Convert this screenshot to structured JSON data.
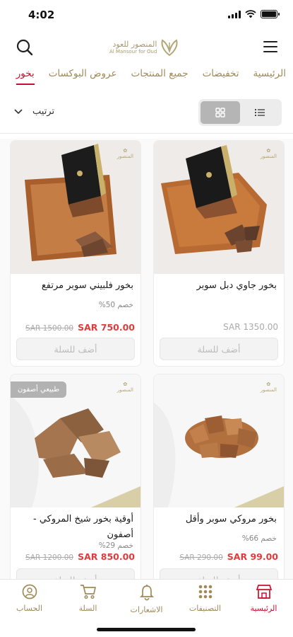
{
  "status_bar": {
    "time": "4:02"
  },
  "header": {
    "logo_ar": "المنصور للعود",
    "logo_en": "Al Mansour for Oud"
  },
  "tabs": [
    {
      "label": "الرئيسية",
      "active": false
    },
    {
      "label": "تخفيضات",
      "active": false
    },
    {
      "label": "جميع المنتجات",
      "active": false
    },
    {
      "label": "عروض البوكسات",
      "active": false
    },
    {
      "label": "بخور",
      "active": true
    }
  ],
  "toolbar": {
    "sort_label": "ترتيب",
    "view_mode": "grid"
  },
  "products": [
    {
      "title": "بخور جاوي دبل سوبر",
      "discount": "",
      "price": "",
      "old_price": "SAR 1350.00",
      "add_label": "أضف للسلة",
      "badge": ""
    },
    {
      "title": "بخور فلبيني سوبر مرتفع",
      "discount": "خصم 50%",
      "price": "SAR 750.00",
      "old_price": "SAR 1500.00",
      "add_label": "أضف للسلة",
      "badge": ""
    },
    {
      "title": "بخور مروكي سوبر وأقل",
      "discount": "خصم 66%",
      "price": "SAR 99.00",
      "old_price": "SAR 290.00",
      "add_label": "أضف للسلة",
      "badge": ""
    },
    {
      "title": "أوقية بخور شيخ المروكي - أصفون",
      "discount": "خصم 29%",
      "price": "SAR 850.00",
      "old_price": "SAR 1200.00",
      "add_label": "أضف للسلة",
      "badge": "طبيعي أصفون"
    }
  ],
  "bottom_nav": [
    {
      "label": "الرئيسية",
      "icon": "store-icon",
      "active": true
    },
    {
      "label": "التصنيفات",
      "icon": "grid-dots-icon",
      "active": false
    },
    {
      "label": "الاشعارات",
      "icon": "bell-icon",
      "active": false
    },
    {
      "label": "السلة",
      "icon": "cart-icon",
      "active": false
    },
    {
      "label": "الحساب",
      "icon": "user-icon",
      "active": false
    }
  ],
  "colors": {
    "accent": "#c8102e",
    "gold": "#a08a5a",
    "price": "#e23a3a"
  }
}
